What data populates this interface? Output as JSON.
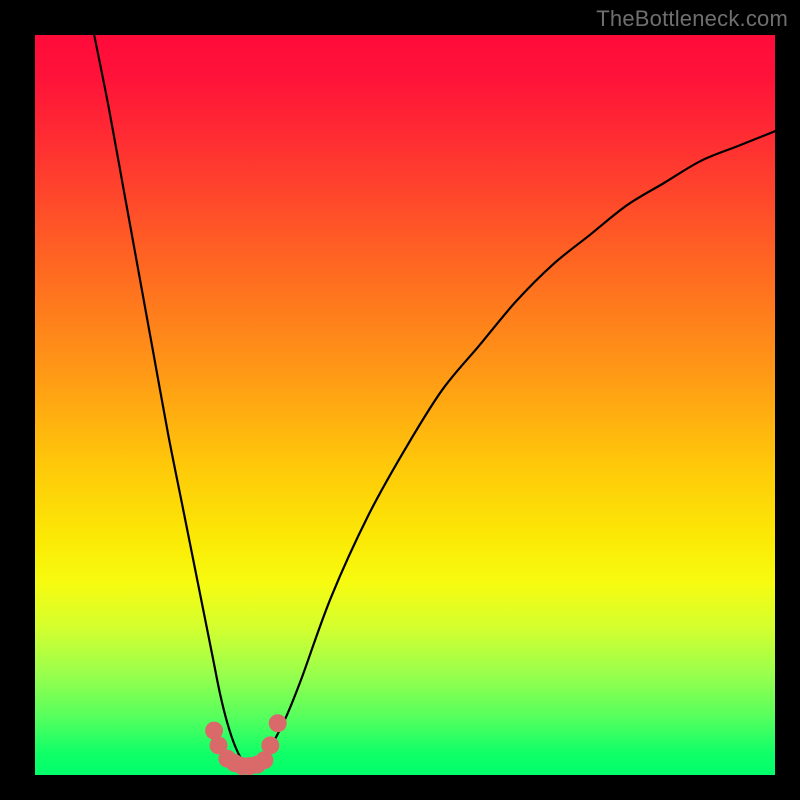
{
  "watermark": "TheBottleneck.com",
  "chart_data": {
    "type": "line",
    "title": "",
    "xlabel": "",
    "ylabel": "",
    "xlim": [
      0,
      100
    ],
    "ylim": [
      0,
      100
    ],
    "grid": false,
    "legend": false,
    "background_gradient": {
      "orientation": "vertical",
      "stops": [
        {
          "pos": 0.0,
          "color": "#ff0b3a"
        },
        {
          "pos": 0.32,
          "color": "#ff6a21"
        },
        {
          "pos": 0.58,
          "color": "#ffc80a"
        },
        {
          "pos": 0.74,
          "color": "#f7fb10"
        },
        {
          "pos": 1.0,
          "color": "#00ff6a"
        }
      ]
    },
    "series": [
      {
        "name": "bottleneck-curve",
        "color": "#000000",
        "x": [
          8,
          10,
          12,
          14,
          16,
          18,
          20,
          22,
          24,
          25,
          26,
          27,
          28,
          29,
          30,
          31,
          32,
          34,
          36,
          40,
          45,
          50,
          55,
          60,
          65,
          70,
          75,
          80,
          85,
          90,
          95,
          100
        ],
        "y": [
          100,
          90,
          79,
          68,
          57,
          46,
          36,
          26,
          16,
          11,
          7,
          4,
          2,
          1,
          1,
          2,
          4,
          8,
          13,
          24,
          35,
          44,
          52,
          58,
          64,
          69,
          73,
          77,
          80,
          83,
          85,
          87
        ]
      }
    ],
    "markers": {
      "name": "near-minimum-points",
      "color": "#da6a6a",
      "x": [
        24.2,
        24.8,
        26.0,
        27.0,
        28.0,
        29.0,
        30.0,
        31.0,
        31.8,
        32.8
      ],
      "y": [
        6.0,
        4.0,
        2.2,
        1.6,
        1.2,
        1.2,
        1.4,
        2.0,
        4.0,
        7.0
      ]
    }
  }
}
